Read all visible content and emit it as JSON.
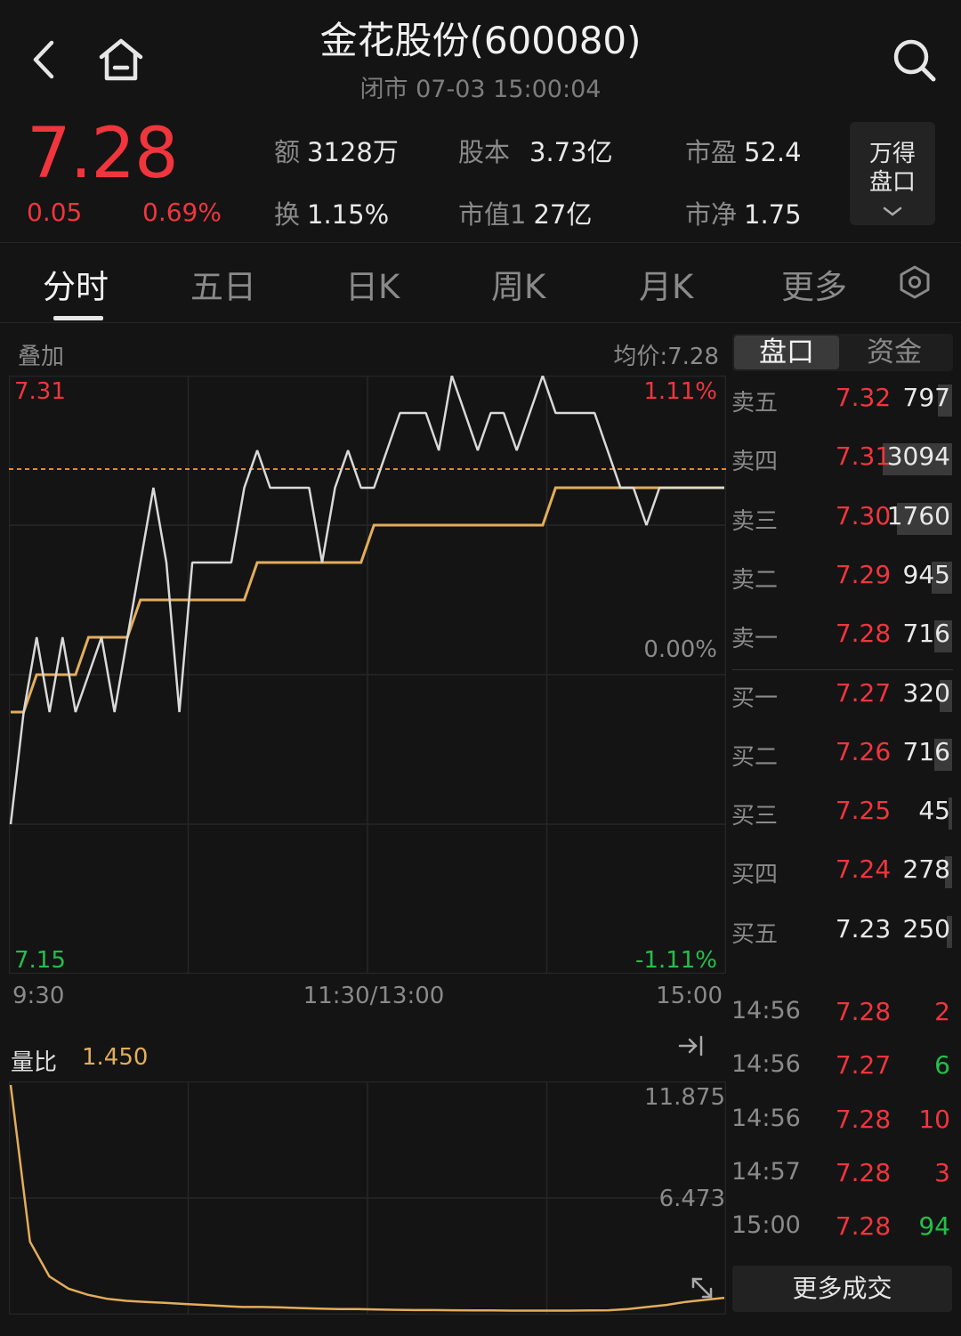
{
  "header": {
    "title": "金花股份(600080)",
    "subtitle": "闭市  07-03 15:00:04"
  },
  "quote": {
    "price": "7.28",
    "change": "0.05",
    "change_pct": "0.69%",
    "stats": [
      {
        "k": "额",
        "v": "3128万"
      },
      {
        "k": "股本",
        "v": "3.73亿"
      },
      {
        "k": "市盈",
        "v": "52.4"
      },
      {
        "k": "换",
        "v": "1.15%"
      },
      {
        "k": "市值1",
        "v": "27亿"
      },
      {
        "k": "市净",
        "v": "1.75"
      }
    ],
    "wind_button": [
      "万得",
      "盘口"
    ]
  },
  "tabs": [
    "分时",
    "五日",
    "日K",
    "周K",
    "月K",
    "更多"
  ],
  "chart": {
    "overlay_label": "叠加",
    "avg_price_label": "均价:7.28",
    "y_max": "7.31",
    "y_min": "7.15",
    "pct_max": "1.11%",
    "pct_zero": "0.00%",
    "pct_min": "-1.11%",
    "x_labels": [
      "9:30",
      "11:30/13:00",
      "15:00"
    ],
    "vol_ratio_label": "量比",
    "vol_ratio_value": "1.450",
    "vol_max": "11.875",
    "vol_mid": "6.473"
  },
  "chart_data": {
    "type": "line",
    "x": [
      "9:30",
      "9:31",
      "9:32",
      "9:33",
      "9:34",
      "9:36",
      "9:38",
      "9:40",
      "9:44",
      "9:48",
      "9:52",
      "9:56",
      "10:00",
      "10:04",
      "10:08",
      "10:12",
      "10:16",
      "10:20",
      "10:25",
      "10:30",
      "10:35",
      "10:40",
      "10:45",
      "10:50",
      "10:55",
      "11:00",
      "11:05",
      "11:10",
      "11:15",
      "11:20",
      "11:25",
      "11:30",
      "13:05",
      "13:10",
      "13:15",
      "13:20",
      "13:25",
      "13:30",
      "13:35",
      "13:40",
      "13:45",
      "13:50",
      "13:55",
      "14:00",
      "14:05",
      "14:10",
      "14:15",
      "14:20",
      "14:25",
      "14:30",
      "14:35",
      "14:40",
      "14:45",
      "14:50",
      "14:55",
      "15:00"
    ],
    "series": [
      {
        "values": [
          7.19,
          7.22,
          7.24,
          7.22,
          7.24,
          7.22,
          7.23,
          7.24,
          7.22,
          7.24,
          7.26,
          7.28,
          7.26,
          7.22,
          7.26,
          7.26,
          7.26,
          7.26,
          7.28,
          7.29,
          7.28,
          7.28,
          7.28,
          7.28,
          7.26,
          7.28,
          7.29,
          7.28,
          7.28,
          7.29,
          7.3,
          7.3,
          7.3,
          7.29,
          7.31,
          7.3,
          7.29,
          7.3,
          7.3,
          7.29,
          7.3,
          7.31,
          7.3,
          7.3,
          7.3,
          7.3,
          7.29,
          7.28,
          7.28,
          7.27,
          7.28,
          7.28,
          7.28,
          7.28,
          7.28,
          7.28
        ]
      },
      {
        "values": [
          7.22,
          7.22,
          7.23,
          7.23,
          7.23,
          7.23,
          7.24,
          7.24,
          7.24,
          7.24,
          7.25,
          7.25,
          7.25,
          7.25,
          7.25,
          7.25,
          7.25,
          7.25,
          7.25,
          7.26,
          7.26,
          7.26,
          7.26,
          7.26,
          7.26,
          7.26,
          7.26,
          7.26,
          7.27,
          7.27,
          7.27,
          7.27,
          7.27,
          7.27,
          7.27,
          7.27,
          7.27,
          7.27,
          7.27,
          7.27,
          7.27,
          7.27,
          7.28,
          7.28,
          7.28,
          7.28,
          7.28,
          7.28,
          7.28,
          7.28,
          7.28,
          7.28,
          7.28,
          7.28,
          7.28,
          7.28
        ]
      }
    ],
    "ylim": [
      7.15,
      7.31
    ],
    "prev_close": 7.23,
    "vol_ratio": {
      "type": "line",
      "values": [
        11.875,
        4.2,
        2.5,
        1.9,
        1.6,
        1.4,
        1.3,
        1.25,
        1.2,
        1.15,
        1.1,
        1.05,
        1.0,
        1.0,
        0.98,
        0.95,
        0.92,
        0.9,
        0.9,
        0.88,
        0.86,
        0.85,
        0.85,
        0.84,
        0.83,
        0.83,
        0.82,
        0.82,
        0.82,
        0.82,
        0.83,
        0.84,
        0.9,
        1.0,
        1.1,
        1.25,
        1.35,
        1.45
      ],
      "ylim": [
        0.8,
        11.875
      ]
    }
  },
  "panel": {
    "tab_pankou": "盘口",
    "tab_zijin": "资金",
    "asks": [
      {
        "label": "卖五",
        "price": "7.32",
        "vol": "797",
        "bar": 0.2
      },
      {
        "label": "卖四",
        "price": "7.31",
        "vol": "3094",
        "bar": 1.0
      },
      {
        "label": "卖三",
        "price": "7.30",
        "vol": "1760",
        "bar": 0.8
      },
      {
        "label": "卖二",
        "price": "7.29",
        "vol": "945",
        "bar": 0.3
      },
      {
        "label": "卖一",
        "price": "7.28",
        "vol": "716",
        "bar": 0.25
      }
    ],
    "bids": [
      {
        "label": "买一",
        "price": "7.27",
        "vol": "320",
        "bar": 0.18
      },
      {
        "label": "买二",
        "price": "7.26",
        "vol": "716",
        "bar": 0.25
      },
      {
        "label": "买三",
        "price": "7.25",
        "vol": "45",
        "bar": 0.05
      },
      {
        "label": "买四",
        "price": "7.24",
        "vol": "278",
        "bar": 0.1
      },
      {
        "label": "买五",
        "price": "7.23",
        "vol": "250",
        "bar": 0.08
      }
    ],
    "trades": [
      {
        "time": "14:56",
        "price": "7.28",
        "vol": "2",
        "dir": "up"
      },
      {
        "time": "14:56",
        "price": "7.27",
        "vol": "6",
        "dir": "down"
      },
      {
        "time": "14:56",
        "price": "7.28",
        "vol": "10",
        "dir": "up"
      },
      {
        "time": "14:57",
        "price": "7.28",
        "vol": "3",
        "dir": "up"
      },
      {
        "time": "15:00",
        "price": "7.28",
        "vol": "94",
        "dir": "down"
      }
    ],
    "more_trades": "更多成交"
  },
  "colors": {
    "up": "#f0353d",
    "down": "#22c04a",
    "price_line": "#d9d9d9",
    "avg_line": "#e3ad5a",
    "ref_line": "#e08a2e"
  }
}
